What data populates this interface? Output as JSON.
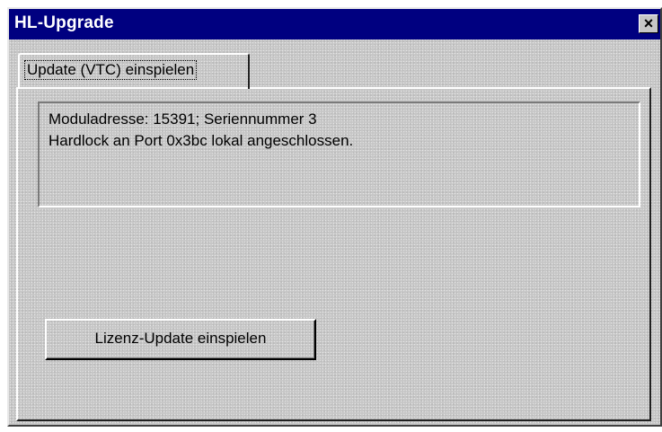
{
  "window": {
    "title": "HL-Upgrade",
    "close_label": "×"
  },
  "tabs": [
    {
      "label": "Update (VTC) einspielen",
      "active": true
    }
  ],
  "info": {
    "line1": "Moduladresse: 15391; Seriennummer 3",
    "line2": "Hardlock an Port 0x3bc lokal angeschlossen."
  },
  "buttons": {
    "update_label": "Lizenz-Update einspielen"
  },
  "colors": {
    "titlebar": "#000080",
    "face": "#c6c6c6"
  }
}
